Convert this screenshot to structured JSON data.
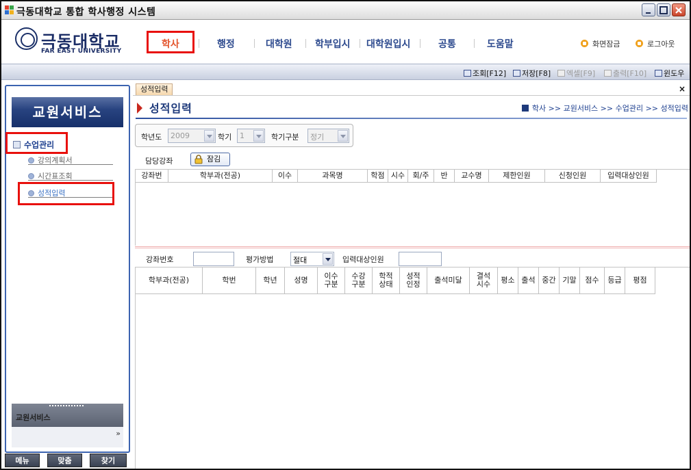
{
  "window": {
    "title": "극동대학교 통합 학사행정 시스템",
    "controls": [
      "minimize",
      "maximize",
      "close"
    ]
  },
  "header": {
    "logo_kr": "극동대학교",
    "logo_en": "FAR EAST UNIVERSITY",
    "nav": [
      "학사",
      "행정",
      "대학원",
      "학부입시",
      "대학원입시",
      "공통",
      "도움말"
    ],
    "active_nav": "학사",
    "screen_lock": "화면잠금",
    "logout": "로그아웃"
  },
  "toolbar": {
    "buttons": [
      {
        "label": "조회[F12]",
        "enabled": true,
        "icon": "search-icon"
      },
      {
        "label": "저장[F8]",
        "enabled": true,
        "icon": "save-icon"
      },
      {
        "label": "엑셀[F9]",
        "enabled": false,
        "icon": "excel-icon"
      },
      {
        "label": "출력[F10]",
        "enabled": false,
        "icon": "print-icon"
      },
      {
        "label": "윈도우",
        "enabled": true,
        "icon": "window-icon"
      }
    ]
  },
  "sidebar": {
    "title": "교원서비스",
    "menu": "수업관리",
    "items": [
      "강의계획서",
      "시간표조회",
      "성적입력"
    ],
    "selected_item": "성적입력",
    "panel_title": "교원서비스",
    "bottom_tabs": [
      "메뉴",
      "맞춤",
      "찾기"
    ]
  },
  "main": {
    "tab_label": "성적입력",
    "page_title": "성적입력",
    "breadcrumb": "학사 >> 교원서비스 >> 수업관리 >> 성적입력",
    "filters": {
      "year_label": "학년도",
      "year_value": "2009",
      "term_label": "학기",
      "term_value": "1",
      "term_type_label": "학기구분",
      "term_type_value": "정기"
    },
    "course_label": "담당강좌",
    "lock_button": "잠김",
    "grid1_headers": [
      "강좌번",
      "학부과(전공)",
      "이수",
      "과목명",
      "학점",
      "시수",
      "회/주",
      "반",
      "교수명",
      "제한인원",
      "신청인원",
      "입력대상인원"
    ],
    "detail": {
      "course_no_label": "강좌번호",
      "course_no_value": "",
      "eval_label": "평가방법",
      "eval_value": "절대",
      "target_label": "입력대상인원",
      "target_value": ""
    },
    "grid2_headers": [
      "학부과(전공)",
      "학번",
      "학년",
      "성명",
      "이수\n구분",
      "수강\n구분",
      "학적\n상태",
      "성적\n인정",
      "출석미달",
      "결석\n시수",
      "평소",
      "출석",
      "중간",
      "기말",
      "점수",
      "등급",
      "평점"
    ]
  },
  "colors": {
    "nav_text": "#2d4a8e",
    "nav_active": "#e3542b",
    "annotation_red": "#e8100c",
    "sidebar_title_bg": "#17306a",
    "sidebar_border": "#3b63b0"
  }
}
